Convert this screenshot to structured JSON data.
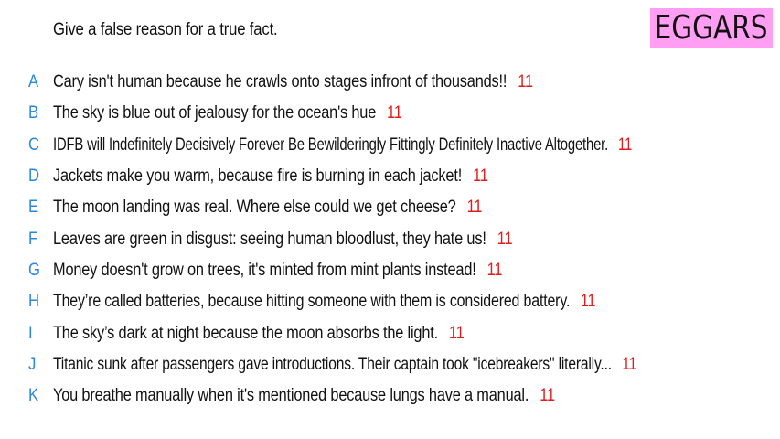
{
  "prompt": "Give a false reason for a true fact.",
  "logo": "EGGARS",
  "answers": [
    {
      "letter": "A",
      "text": "Cary isn't human because he crawls onto stages infront of thousands!!",
      "votes": "11"
    },
    {
      "letter": "B",
      "text": "The sky is blue out of jealousy for the ocean's hue",
      "votes": "11"
    },
    {
      "letter": "C",
      "text": "IDFB will Indefinitely Decisively Forever Be Bewilderingly Fittingly Definitely Inactive Altogether.",
      "votes": "11"
    },
    {
      "letter": "D",
      "text": "Jackets make you warm, because fire is burning in each jacket!",
      "votes": "11"
    },
    {
      "letter": "E",
      "text": "The moon landing was real. Where else could we get cheese?",
      "votes": "11"
    },
    {
      "letter": "F",
      "text": "Leaves are green in disgust: seeing human bloodlust, they hate us!",
      "votes": "11"
    },
    {
      "letter": "G",
      "text": "Money doesn't grow on trees, it's minted from mint plants instead!",
      "votes": "11"
    },
    {
      "letter": "H",
      "text": "They’re called batteries, because hitting someone with them is considered battery.",
      "votes": "11"
    },
    {
      "letter": "I",
      "text": "The sky’s dark at night because the moon absorbs the light.",
      "votes": "11"
    },
    {
      "letter": "J",
      "text": "Titanic sunk after passengers gave introductions. Their captain took \"icebreakers\" literally...",
      "votes": "11"
    },
    {
      "letter": "K",
      "text": "You breathe manually when it's mentioned because lungs have a manual.",
      "votes": "11"
    }
  ],
  "colors": {
    "letter": "#2a87e0",
    "votes": "#e01b1b",
    "logo_bg": "#ff9ef2"
  }
}
